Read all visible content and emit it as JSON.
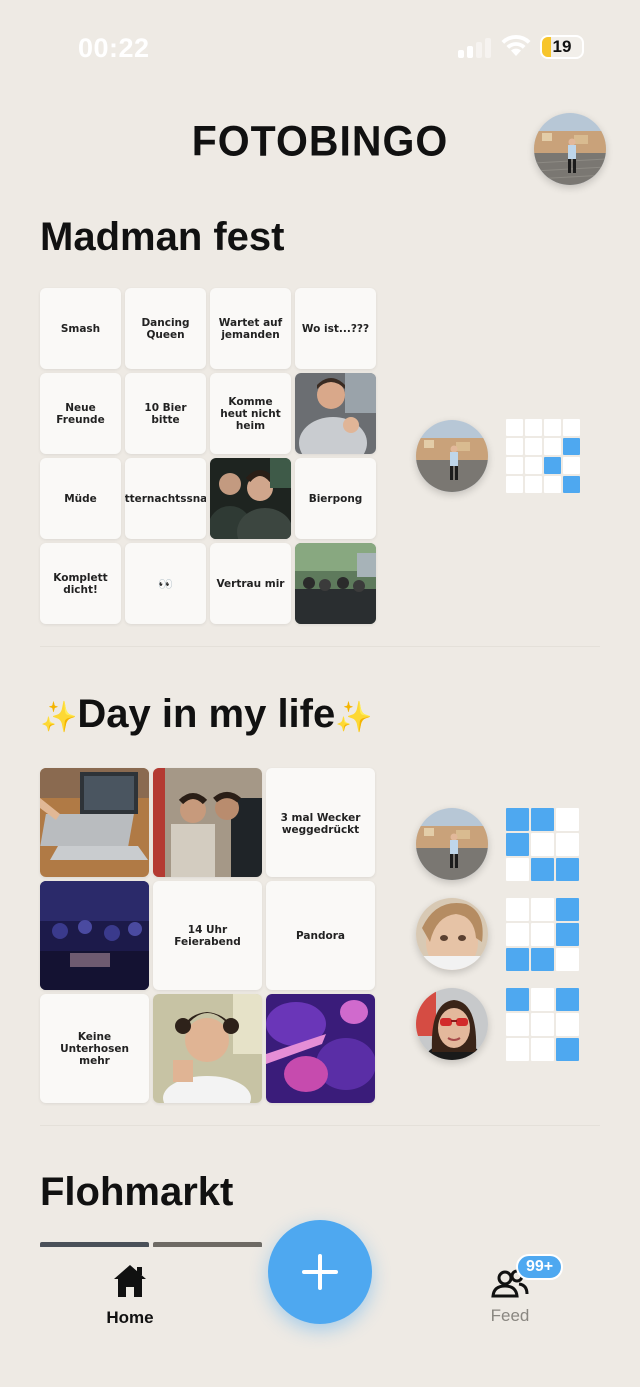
{
  "status_bar": {
    "time": "00:22",
    "battery": "19"
  },
  "app": {
    "title": "FOTOBINGO"
  },
  "sections": [
    {
      "title": "Madman fest",
      "tiles": [
        "Smash",
        "Dancing Queen",
        "Wartet auf jemanden",
        "Wo ist...???",
        "Neue Freunde",
        "10 Bier bitte",
        "Komme heut nicht heim",
        "",
        "Müde",
        "Mitternachtssnack",
        "",
        "Bierpong",
        "Komplett dicht!",
        "👀",
        "Vertrau mir",
        ""
      ],
      "progress": [
        [
          0,
          0,
          0,
          0
        ],
        [
          0,
          0,
          0,
          1
        ],
        [
          0,
          0,
          1,
          0
        ],
        [
          0,
          0,
          0,
          1
        ]
      ]
    },
    {
      "title": "Day in my life",
      "title_prefix": "✨",
      "title_suffix": "✨",
      "tiles": [
        "",
        "",
        "3 mal Wecker weggedrückt",
        "",
        "14 Uhr Feierabend",
        "Pandora",
        "Keine Unterhosen mehr",
        "",
        ""
      ],
      "progress": [
        [
          [
            1,
            1,
            0
          ],
          [
            1,
            0,
            0
          ],
          [
            0,
            1,
            1
          ]
        ],
        [
          [
            0,
            0,
            1
          ],
          [
            0,
            0,
            1
          ],
          [
            1,
            1,
            0
          ]
        ],
        [
          [
            1,
            0,
            1
          ],
          [
            0,
            0,
            0
          ],
          [
            0,
            0,
            1
          ]
        ]
      ]
    },
    {
      "title": "Flohmarkt"
    }
  ],
  "nav": {
    "home": "Home",
    "feed": "Feed",
    "feed_badge": "99+"
  },
  "colors": {
    "accent": "#4EA8F0",
    "background": "#EEEAE4",
    "tile": "#FAF9F7"
  }
}
